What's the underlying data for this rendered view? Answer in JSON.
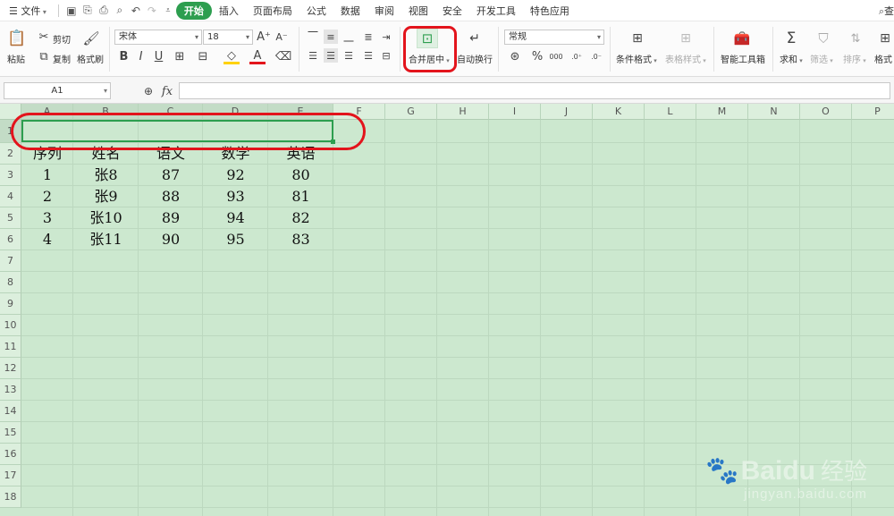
{
  "menubar": {
    "file_label": "文件",
    "tabs": [
      "开始",
      "插入",
      "页面布局",
      "公式",
      "数据",
      "审阅",
      "视图",
      "安全",
      "开发工具",
      "特色应用"
    ],
    "active_tab": "开始",
    "right_search": "查"
  },
  "ribbon": {
    "paste": "粘贴",
    "cut": "剪切",
    "copy": "复制",
    "format_painter": "格式刷",
    "font_name": "宋体",
    "font_size": "18",
    "merge_center": "合并居中",
    "wrap_text": "自动换行",
    "number_format": "常规",
    "conditional_format": "条件格式",
    "table_style": "表格样式",
    "smart_toolbox": "智能工具箱",
    "sum": "求和",
    "filter": "筛选",
    "sort": "排序",
    "format": "格式"
  },
  "formula_bar": {
    "name_box": "A1",
    "fx": "fx"
  },
  "sheet": {
    "columns": [
      "A",
      "B",
      "C",
      "D",
      "E",
      "F",
      "G",
      "H",
      "I",
      "J",
      "K",
      "L",
      "M",
      "N",
      "O",
      "P"
    ],
    "rows": [
      "1",
      "2",
      "3",
      "4",
      "5",
      "6",
      "7",
      "8",
      "9",
      "10",
      "11",
      "12",
      "13",
      "14",
      "15",
      "16",
      "17",
      "18"
    ],
    "table": {
      "header": [
        "序列",
        "姓名",
        "语文",
        "数学",
        "英语"
      ],
      "data": [
        [
          "1",
          "张8",
          "87",
          "92",
          "80"
        ],
        [
          "2",
          "张9",
          "88",
          "93",
          "81"
        ],
        [
          "3",
          "张10",
          "89",
          "94",
          "82"
        ],
        [
          "4",
          "张11",
          "90",
          "95",
          "83"
        ]
      ]
    }
  },
  "watermark": {
    "brand": "Bai",
    "brand2": "du",
    "cn": "经验",
    "url": "jingyan.baidu.com"
  },
  "colors": {
    "accent": "#2d9e4f",
    "sheet_bg": "#cce8cf",
    "annotation": "#e3141c"
  }
}
